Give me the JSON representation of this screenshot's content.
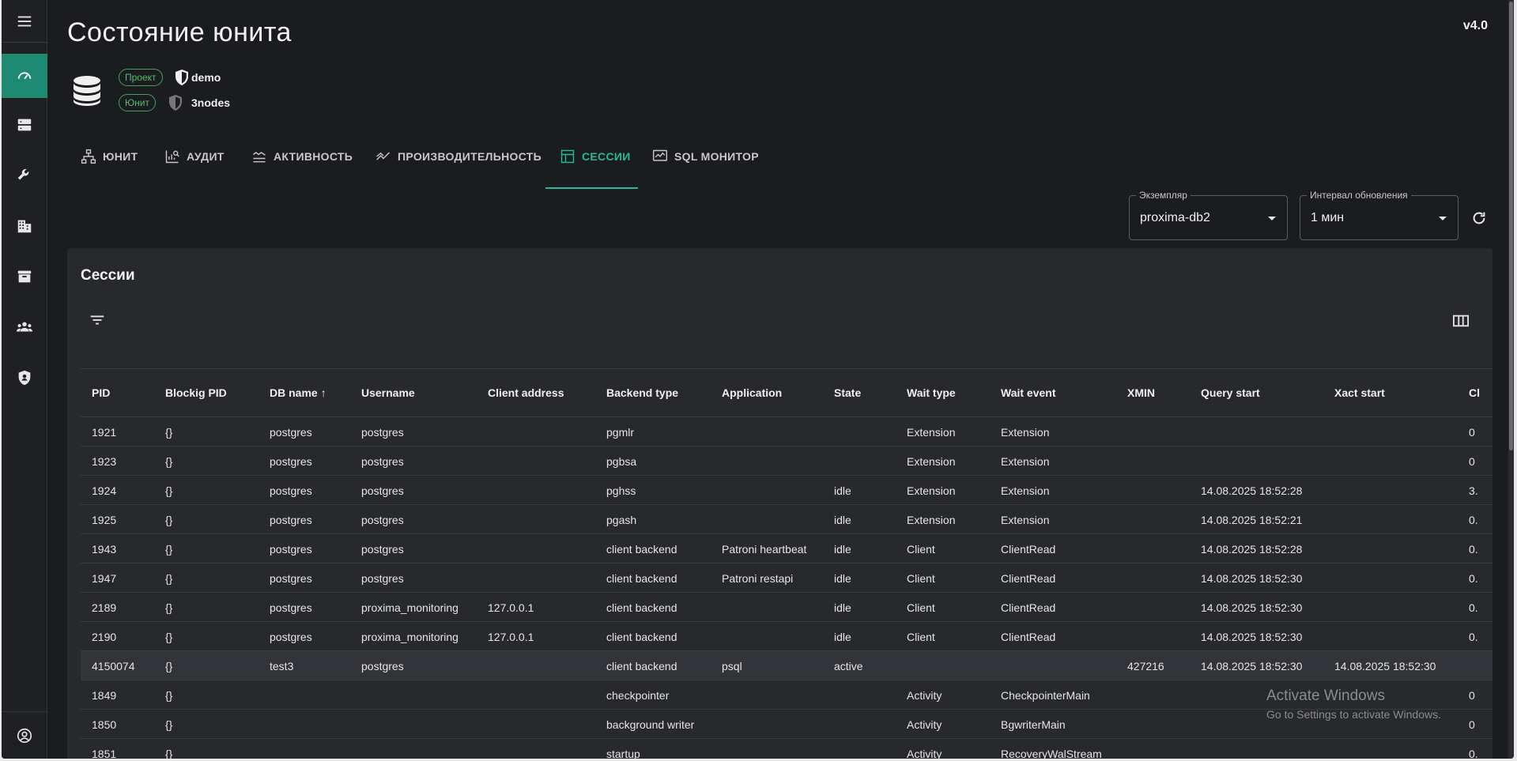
{
  "version": "v4.0",
  "page": {
    "title": "Состояние юнита"
  },
  "meta": {
    "project_chip": "Проект",
    "project_value": "demo",
    "unit_chip": "Юнит",
    "unit_value": "3nodes"
  },
  "tabs": [
    {
      "label": "ЮНИТ",
      "icon": "hierarchy-icon"
    },
    {
      "label": "АУДИТ",
      "icon": "audit-chart-icon"
    },
    {
      "label": "АКТИВНОСТЬ",
      "icon": "activity-lines-icon"
    },
    {
      "label": "ПРОИЗВОДИТЕЛЬНОСТЬ",
      "icon": "performance-trend-icon"
    },
    {
      "label": "СЕССИИ",
      "icon": "table-icon",
      "active": true
    },
    {
      "label": "SQL МОНИТОР",
      "icon": "monitor-chart-icon"
    }
  ],
  "selects": {
    "instance": {
      "label": "Экземпляр",
      "value": "proxima-db2"
    },
    "interval": {
      "label": "Интервал обновления",
      "value": "1 мин"
    }
  },
  "sessions": {
    "title": "Сессии",
    "columns": [
      "PID",
      "Blockig PID",
      "DB name",
      "Username",
      "Client address",
      "Backend type",
      "Application",
      "State",
      "Wait type",
      "Wait event",
      "XMIN",
      "Query start",
      "Xact start",
      "Cl"
    ],
    "sort_indicator": "↑",
    "rows": [
      [
        "1921",
        "{}",
        "postgres",
        "postgres",
        "",
        "pgmlr",
        "",
        "",
        "Extension",
        "Extension",
        "",
        "",
        "",
        "0"
      ],
      [
        "1923",
        "{}",
        "postgres",
        "postgres",
        "",
        "pgbsa",
        "",
        "",
        "Extension",
        "Extension",
        "",
        "",
        "",
        "0"
      ],
      [
        "1924",
        "{}",
        "postgres",
        "postgres",
        "",
        "pghss",
        "",
        "idle",
        "Extension",
        "Extension",
        "",
        "14.08.2025 18:52:28",
        "",
        "3."
      ],
      [
        "1925",
        "{}",
        "postgres",
        "postgres",
        "",
        "pgash",
        "",
        "idle",
        "Extension",
        "Extension",
        "",
        "14.08.2025 18:52:21",
        "",
        "0."
      ],
      [
        "1943",
        "{}",
        "postgres",
        "postgres",
        "",
        "client backend",
        "Patroni heartbeat",
        "idle",
        "Client",
        "ClientRead",
        "",
        "14.08.2025 18:52:28",
        "",
        "0."
      ],
      [
        "1947",
        "{}",
        "postgres",
        "postgres",
        "",
        "client backend",
        "Patroni restapi",
        "idle",
        "Client",
        "ClientRead",
        "",
        "14.08.2025 18:52:30",
        "",
        "0."
      ],
      [
        "2189",
        "{}",
        "postgres",
        "proxima_monitoring",
        "127.0.0.1",
        "client backend",
        "",
        "idle",
        "Client",
        "ClientRead",
        "",
        "14.08.2025 18:52:30",
        "",
        "0."
      ],
      [
        "2190",
        "{}",
        "postgres",
        "proxima_monitoring",
        "127.0.0.1",
        "client backend",
        "",
        "idle",
        "Client",
        "ClientRead",
        "",
        "14.08.2025 18:52:30",
        "",
        "0."
      ],
      [
        "4150074",
        "{}",
        "test3",
        "postgres",
        "",
        "client backend",
        "psql",
        "active",
        "",
        "",
        "427216",
        "14.08.2025 18:52:30",
        "14.08.2025 18:52:30",
        ""
      ],
      [
        "1849",
        "{}",
        "",
        "",
        "",
        "checkpointer",
        "",
        "",
        "Activity",
        "CheckpointerMain",
        "",
        "",
        "",
        "0"
      ],
      [
        "1850",
        "{}",
        "",
        "",
        "",
        "background writer",
        "",
        "",
        "Activity",
        "BgwriterMain",
        "",
        "",
        "",
        "0"
      ],
      [
        "1851",
        "{}",
        "",
        "",
        "",
        "startup",
        "",
        "",
        "Activity",
        "RecoveryWalStream",
        "",
        "",
        "",
        "0."
      ]
    ]
  },
  "watermark": {
    "line1": "Activate Windows",
    "line2": "Go to Settings to activate Windows."
  },
  "colors": {
    "accent": "#26b99a",
    "sidebar_active": "#1e8a72",
    "chip": "#4fbf6a"
  }
}
